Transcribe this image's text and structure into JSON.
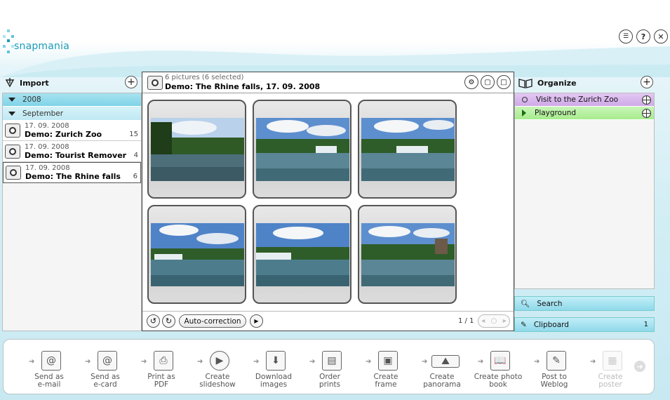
{
  "app": {
    "logo_text": "snapmania"
  },
  "window_controls": {
    "list_icon": "list-icon",
    "help_label": "?",
    "close_label": "✕"
  },
  "import_panel": {
    "title": "Import",
    "year": "2008",
    "month": "September",
    "albums": [
      {
        "date": "17. 09. 2008",
        "name": "Demo: Zurich Zoo",
        "count": "15",
        "selected": false
      },
      {
        "date": "17. 09. 2008",
        "name": "Demo: Tourist Remover",
        "count": "4",
        "selected": false
      },
      {
        "date": "17. 09. 2008",
        "name": "Demo: The Rhine falls",
        "count": "6",
        "selected": true
      }
    ]
  },
  "viewer": {
    "picture_count": "6 pictures (6 selected)",
    "album_title": "Demo: The Rhine falls, 17. 09. 2008",
    "auto_correction_label": "Auto-correction",
    "page_indicator": "1 / 1",
    "thumbnails": [
      {
        "scene": "river-left"
      },
      {
        "scene": "falls-wide"
      },
      {
        "scene": "falls-wide"
      },
      {
        "scene": "falls-sky"
      },
      {
        "scene": "falls-sky"
      },
      {
        "scene": "castle"
      }
    ]
  },
  "organize_panel": {
    "title": "Organize",
    "items": [
      {
        "label": "Visit to the Zurich Zoo",
        "color": "#d4b2ea"
      },
      {
        "label": "Playground",
        "color": "#b1ee99"
      }
    ],
    "search_label": "Search",
    "clipboard_label": "Clipboard",
    "clipboard_count": "1"
  },
  "toolbar": {
    "tools": [
      {
        "line1": "Send as",
        "line2": "e-mail",
        "icon": "@",
        "enabled": true
      },
      {
        "line1": "Send as",
        "line2": "e-card",
        "icon": "@",
        "enabled": true
      },
      {
        "line1": "Print as",
        "line2": "PDF",
        "icon": "⎙",
        "enabled": true
      },
      {
        "line1": "Create",
        "line2": "slideshow",
        "icon": "▶",
        "enabled": true
      },
      {
        "line1": "Download",
        "line2": "images",
        "icon": "⬇",
        "enabled": true
      },
      {
        "line1": "Order",
        "line2": "prints",
        "icon": "▤",
        "enabled": true
      },
      {
        "line1": "Create",
        "line2": "frame",
        "icon": "▣",
        "enabled": true
      },
      {
        "line1": "Create",
        "line2": "panorama",
        "icon": "⛰",
        "enabled": true
      },
      {
        "line1": "Create photo",
        "line2": "book",
        "icon": "📖",
        "enabled": true
      },
      {
        "line1": "Post to",
        "line2": "Weblog",
        "icon": "✎",
        "enabled": true
      },
      {
        "line1": "Create",
        "line2": "poster",
        "icon": "▦",
        "enabled": false
      }
    ]
  },
  "colors": {
    "accent": "#1a9bb8",
    "panel_blue": "#8fd9ea",
    "purple": "#d4b2ea",
    "green": "#b1ee99"
  }
}
